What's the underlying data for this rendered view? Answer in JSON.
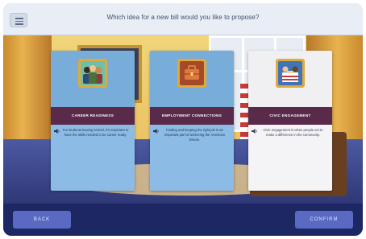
{
  "header": {
    "prompt": "Which idea for a new bill would you like to propose?",
    "menu_icon": "hamburger-menu-icon"
  },
  "cards": [
    {
      "title": "CAREER READINESS",
      "description": "For students leaving school, it's important to have the skills needed to be career ready.",
      "icon": "people-group-icon",
      "selected": false,
      "accent": "#78acd9"
    },
    {
      "title": "EMPLOYMENT CONNECTIONS",
      "description": "Finding and keeping the right job is an important part of achieving the American Dream.",
      "icon": "briefcase-icon",
      "selected": false,
      "accent": "#78acd9"
    },
    {
      "title": "CIVIC ENGAGEMENT",
      "description": "Civic engagement is when people act to make a difference in the community.",
      "icon": "ballot-box-icon",
      "selected": true,
      "accent": "#f0f0f2"
    }
  ],
  "footer": {
    "back_label": "BACK",
    "confirm_label": "CONFIRM"
  },
  "colors": {
    "title_band": "#5a2a4a",
    "footer_bg": "#1d2763",
    "button_bg": "#5a6ac2"
  }
}
